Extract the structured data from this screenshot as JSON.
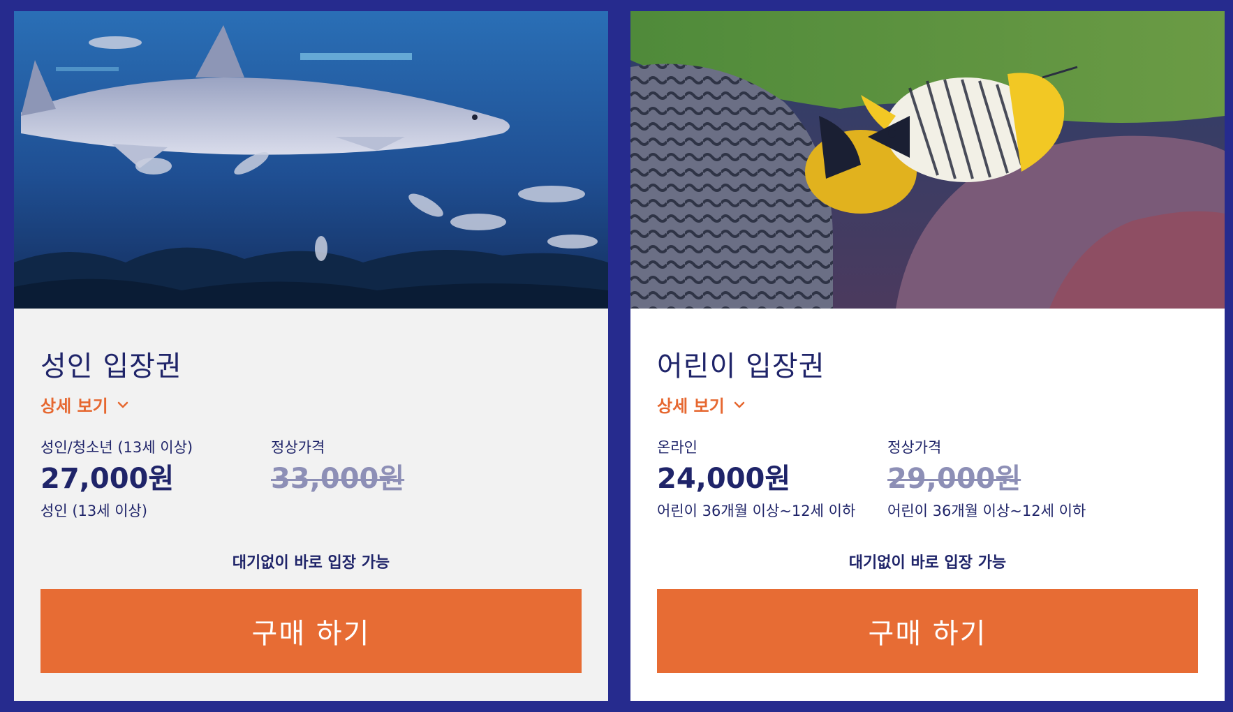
{
  "cards": [
    {
      "title": "성인 입장권",
      "details_label": "상세 보기",
      "image": "shark-aquarium-photo",
      "online": {
        "label": "성인/청소년 (13세 이상)",
        "price": "27,000원",
        "note": "성인 (13세 이상)"
      },
      "regular": {
        "label": "정상가격",
        "price": "33,000원",
        "note": ""
      },
      "entry_note": "대기없이 바로 입장 가능",
      "buy_label": "구매 하기"
    },
    {
      "title": "어린이 입장권",
      "details_label": "상세 보기",
      "image": "butterflyfish-coral-photo",
      "online": {
        "label": "온라인",
        "price": "24,000원",
        "note": "어린이 36개월 이상~12세 이하"
      },
      "regular": {
        "label": "정상가격",
        "price": "29,000원",
        "note": "어린이 36개월 이상~12세 이하"
      },
      "entry_note": "대기없이 바로 입장 가능",
      "buy_label": "구매 하기"
    }
  ],
  "colors": {
    "background": "#262b8e",
    "accent": "#e76c34",
    "text_dark": "#1f2469",
    "strike_price": "#8d8fb6"
  }
}
